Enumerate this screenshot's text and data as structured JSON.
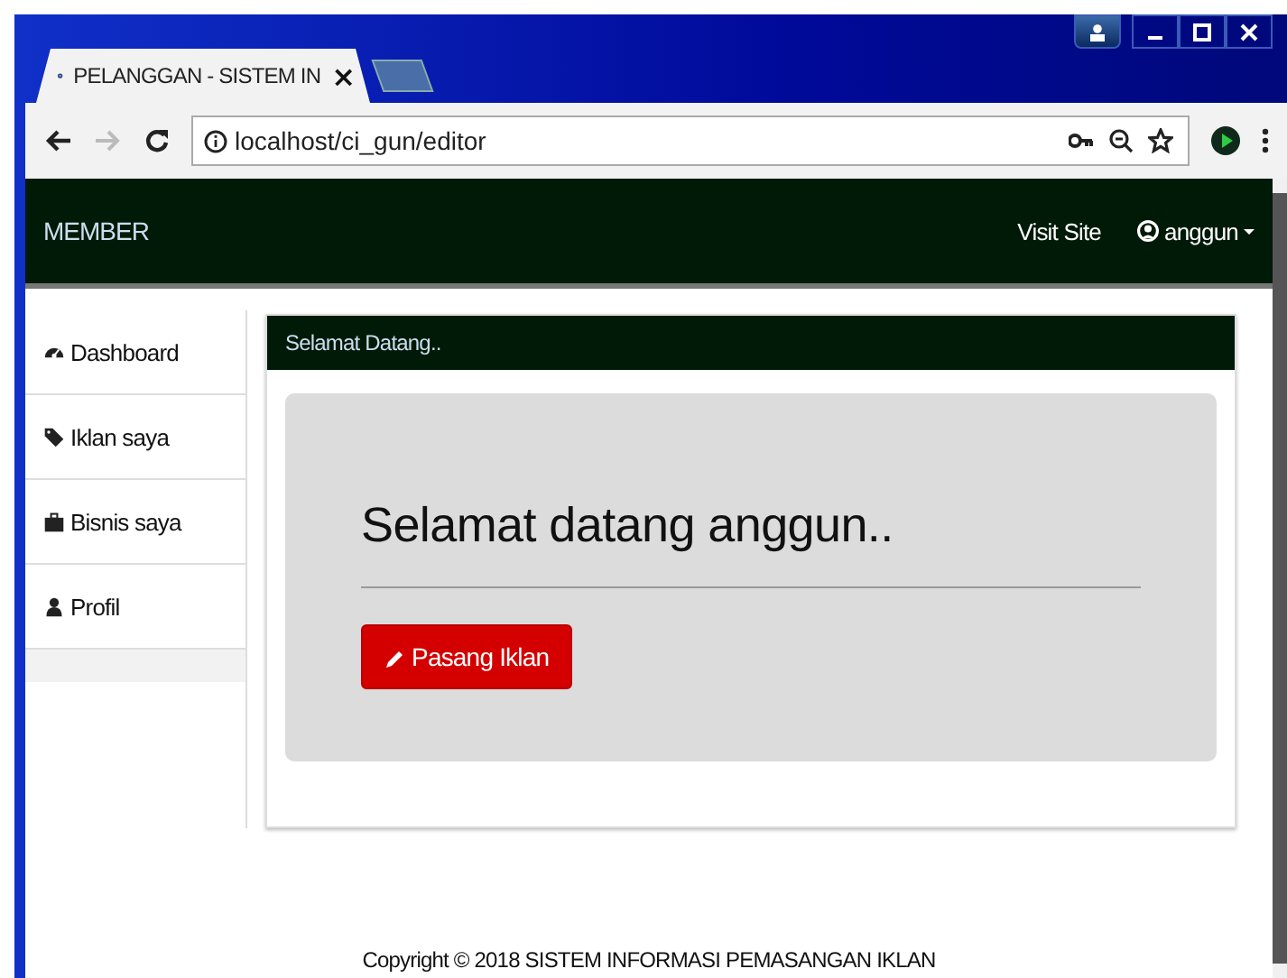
{
  "browser": {
    "tab_title": "PELANGGAN - SISTEM IN",
    "tab_close": "×",
    "address": "localhost/ci_gun/editor"
  },
  "navbar": {
    "brand": "MEMBER",
    "links": [
      {
        "label": "Visit Site",
        "kind": "link"
      },
      {
        "label": "anggun",
        "kind": "user"
      }
    ]
  },
  "sidebar": {
    "items": [
      {
        "label": "Dashboard",
        "kind": "dashboard"
      },
      {
        "label": "Iklan saya",
        "kind": "tag"
      },
      {
        "label": "Bisnis saya",
        "kind": "briefcase"
      },
      {
        "label": "Profil",
        "kind": "user"
      }
    ]
  },
  "panel": {
    "heading": "Selamat Datang..",
    "welcome": "Selamat datang anggun..",
    "button": "Pasang Iklan"
  },
  "footer": "Copyright © 2018 SISTEM INFORMASI PEMASANGAN IKLAN"
}
